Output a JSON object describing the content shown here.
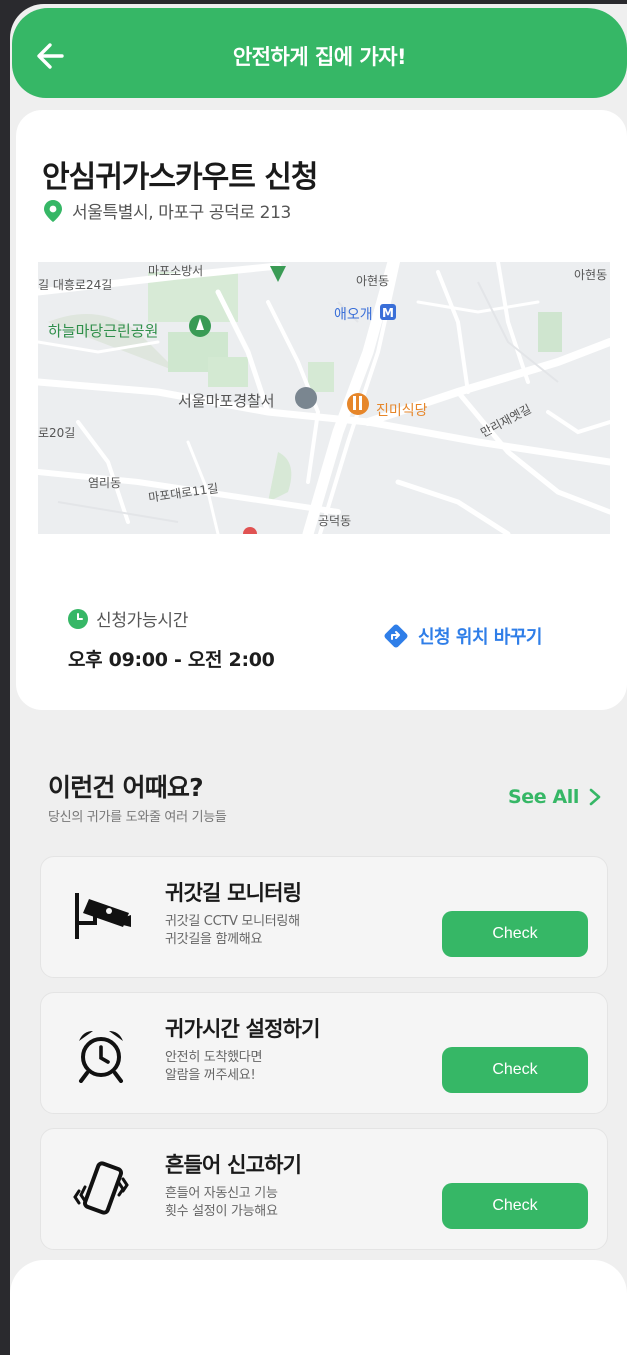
{
  "header": {
    "title": "안전하게 집에 가자!",
    "back_icon": "arrow-left-icon"
  },
  "scout": {
    "title": "안심귀가스카우트 신청",
    "address": "서울특별시, 마포구 공덕로 213",
    "map_labels": {
      "daeheung": "길 대흥로24길",
      "fire_station": "마포소방서",
      "ahyeon": "아현동",
      "ahyeon_right": "아현동",
      "aeogae": "애오개",
      "park": "하늘마당근린공원",
      "police": "서울마포경찰서",
      "restaurant": "진미식당",
      "manri": "만리재옛길",
      "road20": "로20길",
      "yeomni": "염리동",
      "mapodaero": "마포대로11길",
      "gongdeok": "공덕동"
    },
    "available_label": "신청가능시간",
    "available_time": "오후 09:00 - 오전 2:00",
    "change_location": "신청 위치 바꾸기"
  },
  "suggestions": {
    "title": "이런건 어때요?",
    "subtitle": "당신의 귀가를 도와줄 여러 기능들",
    "see_all": "See All"
  },
  "features": [
    {
      "title": "귀갓길 모니터링",
      "desc1": "귀갓길 CCTV 모니터링해",
      "desc2": "귀갓길을 함께해요",
      "button": "Check",
      "icon": "cctv-camera-icon"
    },
    {
      "title": "귀가시간 설정하기",
      "desc1": "안전히 도착했다면",
      "desc2": "알람을 꺼주세요!",
      "button": "Check",
      "icon": "alarm-clock-icon"
    },
    {
      "title": "흔들어 신고하기",
      "desc1": "흔들어 자동신고 기능",
      "desc2": "횟수 설정이 가능해요",
      "button": "Check",
      "icon": "shaking-phone-icon"
    }
  ],
  "colors": {
    "brand_green": "#36b766",
    "link_blue": "#2f7ee8"
  }
}
